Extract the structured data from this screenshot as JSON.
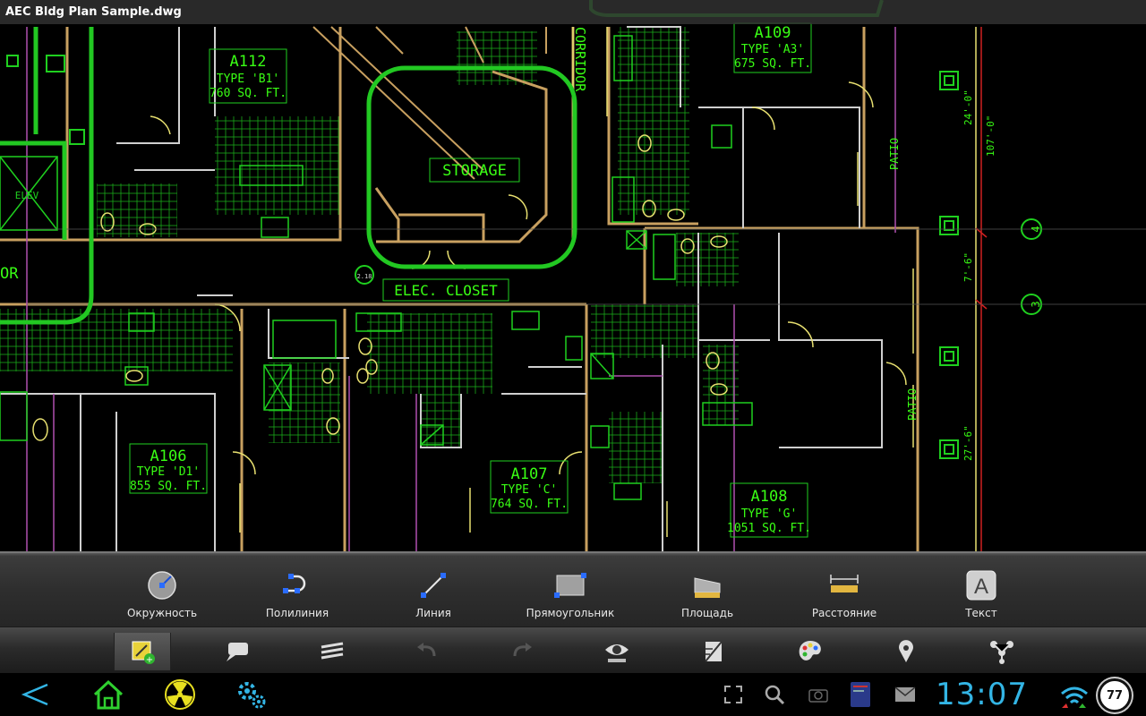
{
  "window": {
    "title": "AEC Bldg Plan Sample.dwg"
  },
  "drawing": {
    "units": [
      {
        "name": "A112",
        "type": "TYPE 'B1'",
        "area": "760 SQ. FT."
      },
      {
        "name": "A109",
        "type": "TYPE 'A3'",
        "area": "675 SQ. FT."
      },
      {
        "name": "A106",
        "type": "TYPE 'D1'",
        "area": "855 SQ. FT."
      },
      {
        "name": "A107",
        "type": "TYPE 'C'",
        "area": "764 SQ. FT."
      },
      {
        "name": "A108",
        "type": "TYPE 'G'",
        "area": "1051 SQ. FT."
      }
    ],
    "labels": {
      "storage": "STORAGE",
      "elec_closet": "ELEC. CLOSET",
      "corridor": "CORRIDOR",
      "corridor_left": "OR",
      "elev": "ELEV",
      "patio": "PATIO",
      "tag": "2.18"
    },
    "dimensions": [
      "24'-0\"",
      "107'-0\"",
      "7'-6\"",
      "27'-6\""
    ],
    "gridlines": [
      "4",
      "3"
    ],
    "colors": {
      "wall": "#c8a060",
      "fixture": "#1fd01f",
      "text": "#39ff14",
      "highlight": "#22c822",
      "interior": "#cfcfcf",
      "partition": "#b050b0"
    }
  },
  "draw_toolbar": {
    "tools": [
      {
        "label": "Окружность",
        "icon": "circle-tool-icon"
      },
      {
        "label": "Полилиния",
        "icon": "polyline-tool-icon"
      },
      {
        "label": "Линия",
        "icon": "line-tool-icon"
      },
      {
        "label": "Прямоугольник",
        "icon": "rectangle-tool-icon"
      },
      {
        "label": "Площадь",
        "icon": "area-tool-icon"
      },
      {
        "label": "Расстояние",
        "icon": "distance-tool-icon"
      },
      {
        "label": "Текст",
        "icon": "text-tool-icon"
      }
    ]
  },
  "bottom_toolbar": {
    "buttons": [
      {
        "name": "markup-edit-icon",
        "active": true
      },
      {
        "name": "comment-icon"
      },
      {
        "name": "layers-icon"
      },
      {
        "name": "undo-icon"
      },
      {
        "name": "redo-icon"
      },
      {
        "name": "view-icon"
      },
      {
        "name": "snap-icon"
      },
      {
        "name": "palette-icon"
      },
      {
        "name": "location-pin-icon"
      },
      {
        "name": "share-icon"
      }
    ]
  },
  "system_bar": {
    "clock": "13:07",
    "battery": "77",
    "accent": "#33b5e5"
  }
}
